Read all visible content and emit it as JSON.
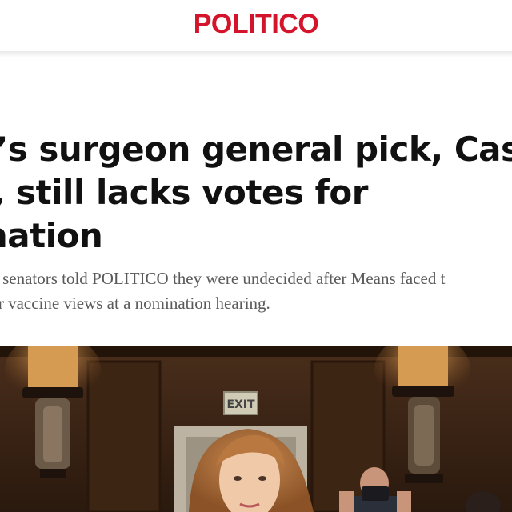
{
  "header": {
    "logo_text": "POLITICO",
    "brand_color": "#d4142a"
  },
  "article": {
    "headline_lines": [
      "o’s surgeon general pick, Casey",
      "s, still lacks votes for",
      "mation"
    ],
    "dek_lines": [
      "an senators told POLITICO they were undecided after Means faced t",
      "ner vaccine views at a nomination hearing."
    ]
  },
  "photo": {
    "exit_sign_text": "EXIT"
  }
}
